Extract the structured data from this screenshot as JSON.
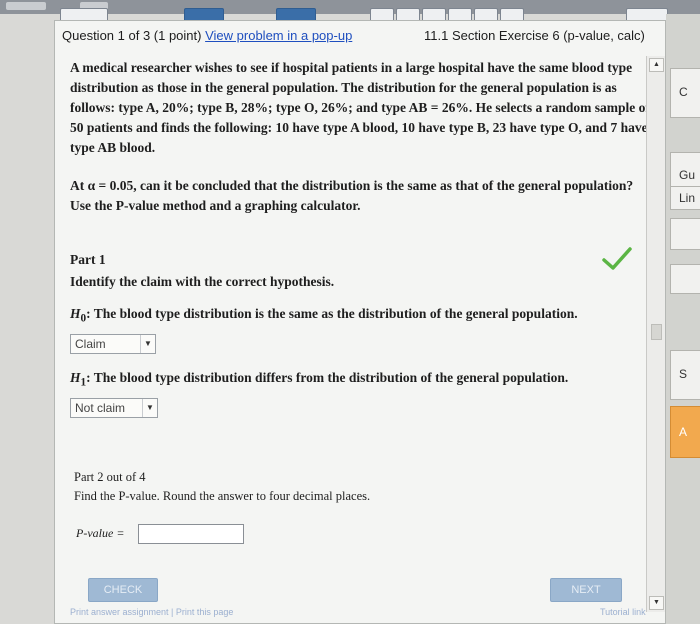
{
  "header": {
    "question_label": "Question 1 of 3 (1 point)",
    "popup_link": "View problem in a pop-up",
    "section": "11.1 Section Exercise 6 (p-value, calc)"
  },
  "problem": {
    "paragraph1": "A medical researcher wishes to see if hospital patients in a large hospital have the same blood type distribution as those in the general population. The distribution for the general population is as follows: type A, 20%; type B, 28%; type O, 26%; and type AB = 26%. He selects a random sample of 50 patients and finds the following: 10 have type A blood, 10 have type B, 23 have type O, and 7 have type AB blood.",
    "paragraph2": "At α = 0.05, can it be concluded that the distribution is the same as that of the general population? Use the P-value method and a graphing calculator."
  },
  "part1": {
    "title": "Part 1",
    "instruction": "Identify the claim with the correct hypothesis.",
    "h0_symbol": "H",
    "h0_sub": "0",
    "h0_text": ": The blood type distribution is the same as the distribution of the general population.",
    "h0_select": "Claim",
    "h1_symbol": "H",
    "h1_sub": "1",
    "h1_text": ": The blood type distribution differs from the distribution of the general population.",
    "h1_select": "Not claim"
  },
  "part2": {
    "title": "Part 2 out of 4",
    "instruction": "Find the P-value. Round the answer to four decimal places.",
    "answer_label": "P-value =",
    "answer_value": ""
  },
  "buttons": {
    "check": "CHECK",
    "next": "NEXT"
  },
  "footer": {
    "link1": "Print answer assignment",
    "link2": "Print this page",
    "tutorial": "Tutorial link"
  },
  "right_panel": {
    "box1": "C",
    "box2": "Gu",
    "box3": "Lin",
    "box4": "S",
    "box5": "A"
  },
  "colors": {
    "link": "#1f4fbf",
    "check_green": "#5bb544",
    "button_blue": "#9fb9d4",
    "right_orange": "#f2a94e"
  }
}
